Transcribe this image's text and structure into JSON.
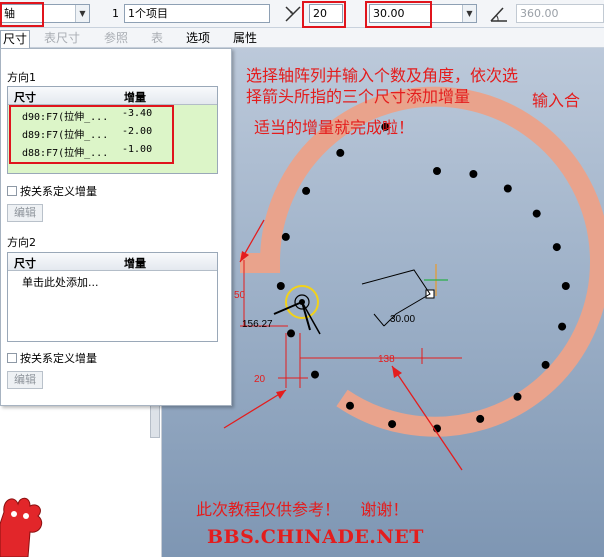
{
  "toolbar": {
    "pattern_type": "轴",
    "count_label": "1",
    "items_field": "1个项目",
    "member_count": "20",
    "angle_increment": "30.00",
    "total_angle": "360.00"
  },
  "tabs": [
    {
      "label": "尺寸",
      "state": "active"
    },
    {
      "label": "表尺寸",
      "state": "disabled"
    },
    {
      "label": "参照",
      "state": "disabled"
    },
    {
      "label": "表",
      "state": "disabled"
    },
    {
      "label": "选项",
      "state": "enabled"
    },
    {
      "label": "属性",
      "state": "enabled"
    }
  ],
  "panel": {
    "direction1": {
      "title": "方向1",
      "col_dim": "尺寸",
      "col_inc": "增量",
      "rows": [
        {
          "dim": "d90:F7(拉伸_...",
          "inc": "-3.40"
        },
        {
          "dim": "d89:F7(拉伸_...",
          "inc": "-2.00"
        },
        {
          "dim": "d88:F7(拉伸_...",
          "inc": "-1.00"
        }
      ],
      "relation_checkbox": "按关系定义增量",
      "edit_button": "编辑"
    },
    "direction2": {
      "title": "方向2",
      "col_dim": "尺寸",
      "col_inc": "增量",
      "placeholder_row": "单击此处添加...",
      "relation_checkbox": "按关系定义增量",
      "edit_button": "编辑"
    }
  },
  "annotations": {
    "line1": "选择轴阵列并输入个数及角度，依次选",
    "line2": "择箭头所指的三个尺寸添加增量",
    "line2b": "输入合",
    "line3": "适当的增量就完成啦！",
    "footer_note": "此次教程仅供参考！    谢谢！",
    "watermark": "BBS.CHINADE.NET"
  },
  "dimensions": {
    "d50": "50",
    "d156": "156.27",
    "d30": "30.00",
    "d138": "138",
    "d20": "20"
  },
  "colors": {
    "highlight": "#e0141c",
    "spiral": "#e9a38c",
    "annotation_text": "#e41d1d",
    "table_green": "#dcf5c8"
  }
}
